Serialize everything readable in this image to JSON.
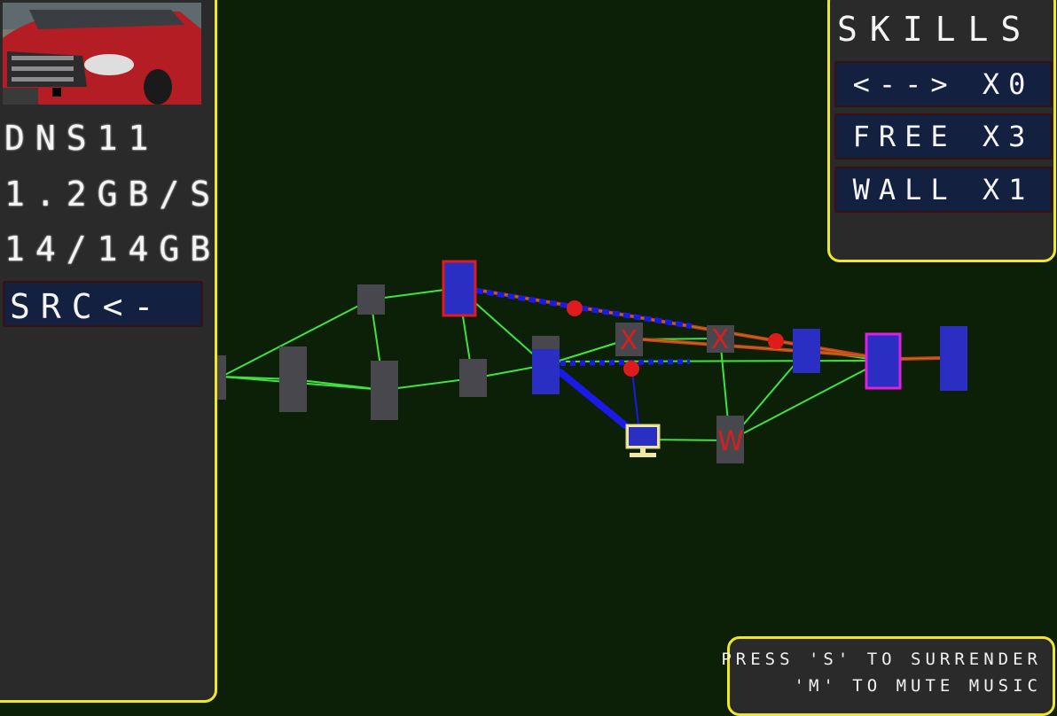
{
  "target": {
    "host_name": "DNS11",
    "speed": "1.2GB/S",
    "storage": "14/14GB",
    "photo_icon": "red-minivan-photo"
  },
  "source_slot": {
    "label": "SRC<-"
  },
  "skills": {
    "title": "SKILLS",
    "items": [
      {
        "label": "<--> X0"
      },
      {
        "label": "FREE X3"
      },
      {
        "label": "WALL X1"
      }
    ]
  },
  "help": {
    "line1": "PRESS 'S' TO SURRENDER",
    "line2": "'M' TO MUTE MUSIC"
  },
  "network": {
    "node_markers": {
      "blocked": "X",
      "wall": "W"
    },
    "colors": {
      "background": "#0c1f07",
      "link": "#3fe23f",
      "idle_node": "#47474d",
      "owned_node": "#2a2ec2",
      "packet": "#1a1ae6",
      "attack_trace": "#e01b1b",
      "selected_source": "#e01b1b",
      "selected_target": "#e020e0",
      "panel_border": "#f0e62a"
    },
    "terminal_icon": "computer-monitor-icon"
  }
}
